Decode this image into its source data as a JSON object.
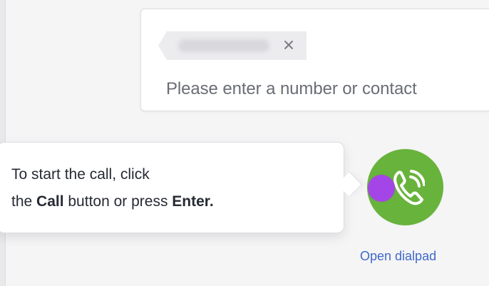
{
  "recipient_input": {
    "chip": {
      "close_label": "×"
    },
    "placeholder": "Please enter a number or contact"
  },
  "tooltip": {
    "line1": "To start the call, click",
    "line2_before_call": "the ",
    "line2_call": "Call",
    "line2_middle": " button or press ",
    "line2_enter": "Enter."
  },
  "actions": {
    "dialpad_link": "Open dialpad"
  },
  "colors": {
    "call_button": "#68b33c",
    "focus_indicator": "#a445e8",
    "link": "#3f69c8"
  },
  "icons": {
    "chip_close": "close-icon",
    "call": "phone-icon"
  }
}
